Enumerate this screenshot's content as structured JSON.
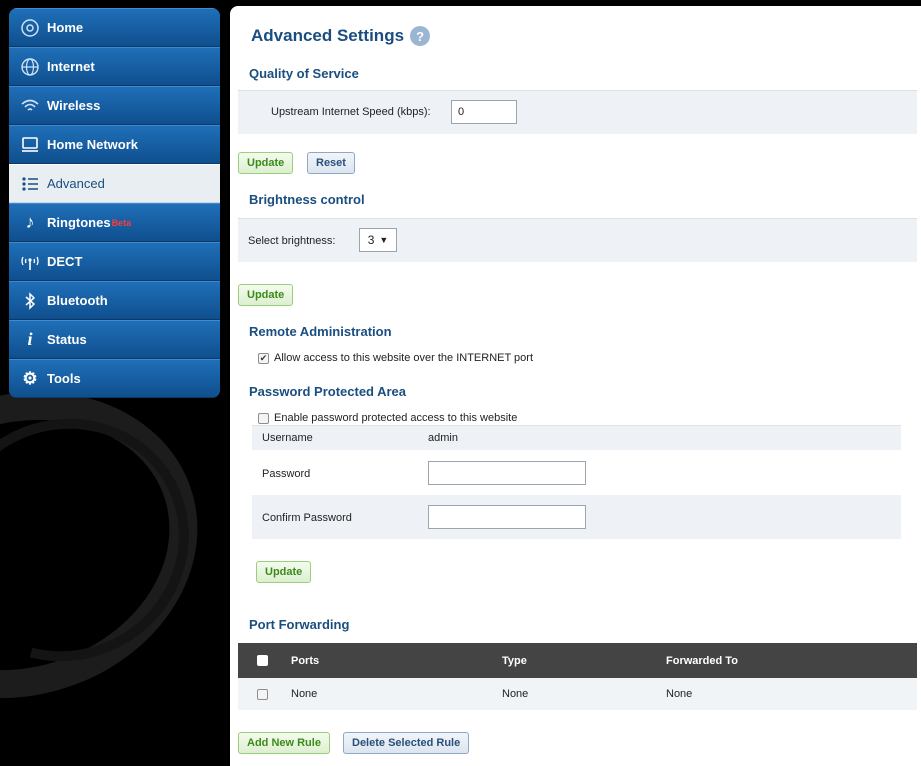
{
  "sidebar": {
    "items": [
      {
        "label": "Home",
        "icon": "home-icon"
      },
      {
        "label": "Internet",
        "icon": "globe-icon"
      },
      {
        "label": "Wireless",
        "icon": "wifi-icon"
      },
      {
        "label": "Home Network",
        "icon": "monitor-icon"
      },
      {
        "label": "Advanced",
        "icon": "list-icon",
        "active": true
      },
      {
        "label": "Ringtones",
        "icon": "music-note-icon",
        "badge": "Beta"
      },
      {
        "label": "DECT",
        "icon": "dect-icon"
      },
      {
        "label": "Bluetooth",
        "icon": "bluetooth-icon"
      },
      {
        "label": "Status",
        "icon": "info-icon"
      },
      {
        "label": "Tools",
        "icon": "gear-icon"
      }
    ]
  },
  "page": {
    "title": "Advanced Settings",
    "help_glyph": "?"
  },
  "qos": {
    "title": "Quality of Service",
    "upstream_label": "Upstream Internet Speed (kbps):",
    "upstream_value": "0",
    "update_label": "Update",
    "reset_label": "Reset"
  },
  "brightness": {
    "title": "Brightness control",
    "select_label": "Select brightness:",
    "selected": "3",
    "update_label": "Update"
  },
  "remote": {
    "title": "Remote Administration",
    "allow_label": "Allow access to this website over the INTERNET port",
    "allow_checked": true
  },
  "password": {
    "title": "Password Protected Area",
    "enable_label": "Enable password protected access to this website",
    "enable_checked": false,
    "username_label": "Username",
    "username_value": "admin",
    "password_label": "Password",
    "confirm_label": "Confirm Password",
    "update_label": "Update"
  },
  "port_forwarding": {
    "title": "Port Forwarding",
    "columns": [
      "Ports",
      "Type",
      "Forwarded To"
    ],
    "rows": [
      [
        "None",
        "None",
        "None"
      ]
    ],
    "add_label": "Add New Rule",
    "delete_label": "Delete Selected Rule"
  },
  "colors": {
    "nav_blue": "#1f6fb8",
    "title_blue": "#1a4e80",
    "button_green": "#3c8a1c",
    "table_header": "#444444"
  }
}
